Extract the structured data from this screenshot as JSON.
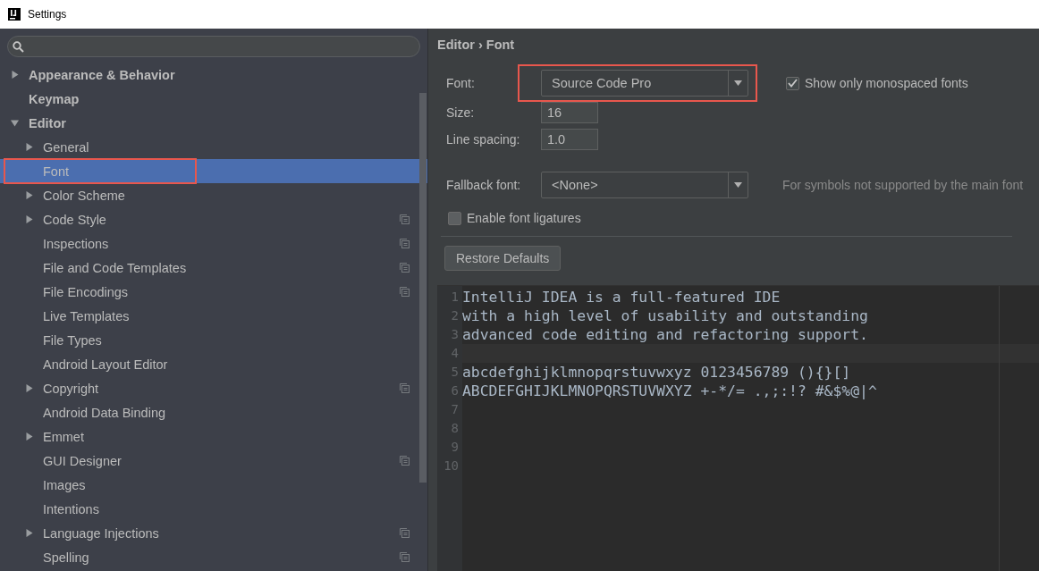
{
  "window": {
    "title": "Settings"
  },
  "sidebar": {
    "items": [
      {
        "label": "Appearance & Behavior",
        "expanded": false,
        "selected": false,
        "annotated": false,
        "scoped": false
      },
      {
        "label": "Keymap",
        "selected": false,
        "annotated": false,
        "scoped": false
      },
      {
        "label": "Editor",
        "expanded": true,
        "selected": false,
        "annotated": false,
        "scoped": false,
        "children": [
          {
            "label": "General",
            "expanded": false,
            "selected": false,
            "annotated": false,
            "scoped": false
          },
          {
            "label": "Font",
            "selected": true,
            "annotated": true,
            "scoped": false
          },
          {
            "label": "Color Scheme",
            "expanded": false,
            "selected": false,
            "annotated": false,
            "scoped": false
          },
          {
            "label": "Code Style",
            "expanded": false,
            "selected": false,
            "annotated": false,
            "scoped": true
          },
          {
            "label": "Inspections",
            "selected": false,
            "annotated": false,
            "scoped": true
          },
          {
            "label": "File and Code Templates",
            "selected": false,
            "annotated": false,
            "scoped": true
          },
          {
            "label": "File Encodings",
            "selected": false,
            "annotated": false,
            "scoped": true
          },
          {
            "label": "Live Templates",
            "selected": false,
            "annotated": false,
            "scoped": false
          },
          {
            "label": "File Types",
            "selected": false,
            "annotated": false,
            "scoped": false
          },
          {
            "label": "Android Layout Editor",
            "selected": false,
            "annotated": false,
            "scoped": false
          },
          {
            "label": "Copyright",
            "expanded": false,
            "selected": false,
            "annotated": false,
            "scoped": true
          },
          {
            "label": "Android Data Binding",
            "selected": false,
            "annotated": false,
            "scoped": false
          },
          {
            "label": "Emmet",
            "expanded": false,
            "selected": false,
            "annotated": false,
            "scoped": false
          },
          {
            "label": "GUI Designer",
            "selected": false,
            "annotated": false,
            "scoped": true
          },
          {
            "label": "Images",
            "selected": false,
            "annotated": false,
            "scoped": false
          },
          {
            "label": "Intentions",
            "selected": false,
            "annotated": false,
            "scoped": false
          },
          {
            "label": "Language Injections",
            "expanded": false,
            "selected": false,
            "annotated": false,
            "scoped": true
          },
          {
            "label": "Spelling",
            "selected": false,
            "annotated": false,
            "scoped": true
          }
        ]
      }
    ]
  },
  "breadcrumb": {
    "parent": "Editor",
    "separator": "›",
    "current": "Font"
  },
  "form": {
    "font": {
      "label": "Font:",
      "value": "Source Code Pro",
      "annotated": true
    },
    "monospaced": {
      "label": "Show only monospaced fonts",
      "checked": true
    },
    "size": {
      "label": "Size:",
      "value": "16"
    },
    "line_spacing": {
      "label": "Line spacing:",
      "value": "1.0"
    },
    "fallback": {
      "label": "Fallback font:",
      "value": "<None>",
      "hint": "For symbols not supported by the main font"
    },
    "ligatures": {
      "label": "Enable font ligatures",
      "checked": false
    },
    "restore_button": "Restore Defaults"
  },
  "preview": {
    "lines": [
      {
        "number": "1",
        "text": "IntelliJ IDEA is a full-featured IDE",
        "current": false
      },
      {
        "number": "2",
        "text": "with a high level of usability and outstanding",
        "current": false
      },
      {
        "number": "3",
        "text": "advanced code editing and refactoring support.",
        "current": false
      },
      {
        "number": "4",
        "current": true
      },
      {
        "number": "5",
        "text": "abcdefghijklmnopqrstuvwxyz 0123456789 (){}[]",
        "current": false
      },
      {
        "number": "6",
        "text": "ABCDEFGHIJKLMNOPQRSTUVWXYZ +-*/= .,;:!? #&$%@|^",
        "current": false
      },
      {
        "number": "7",
        "current": false
      },
      {
        "number": "8",
        "current": false
      },
      {
        "number": "9",
        "current": false
      },
      {
        "number": "10",
        "current": false
      }
    ]
  }
}
